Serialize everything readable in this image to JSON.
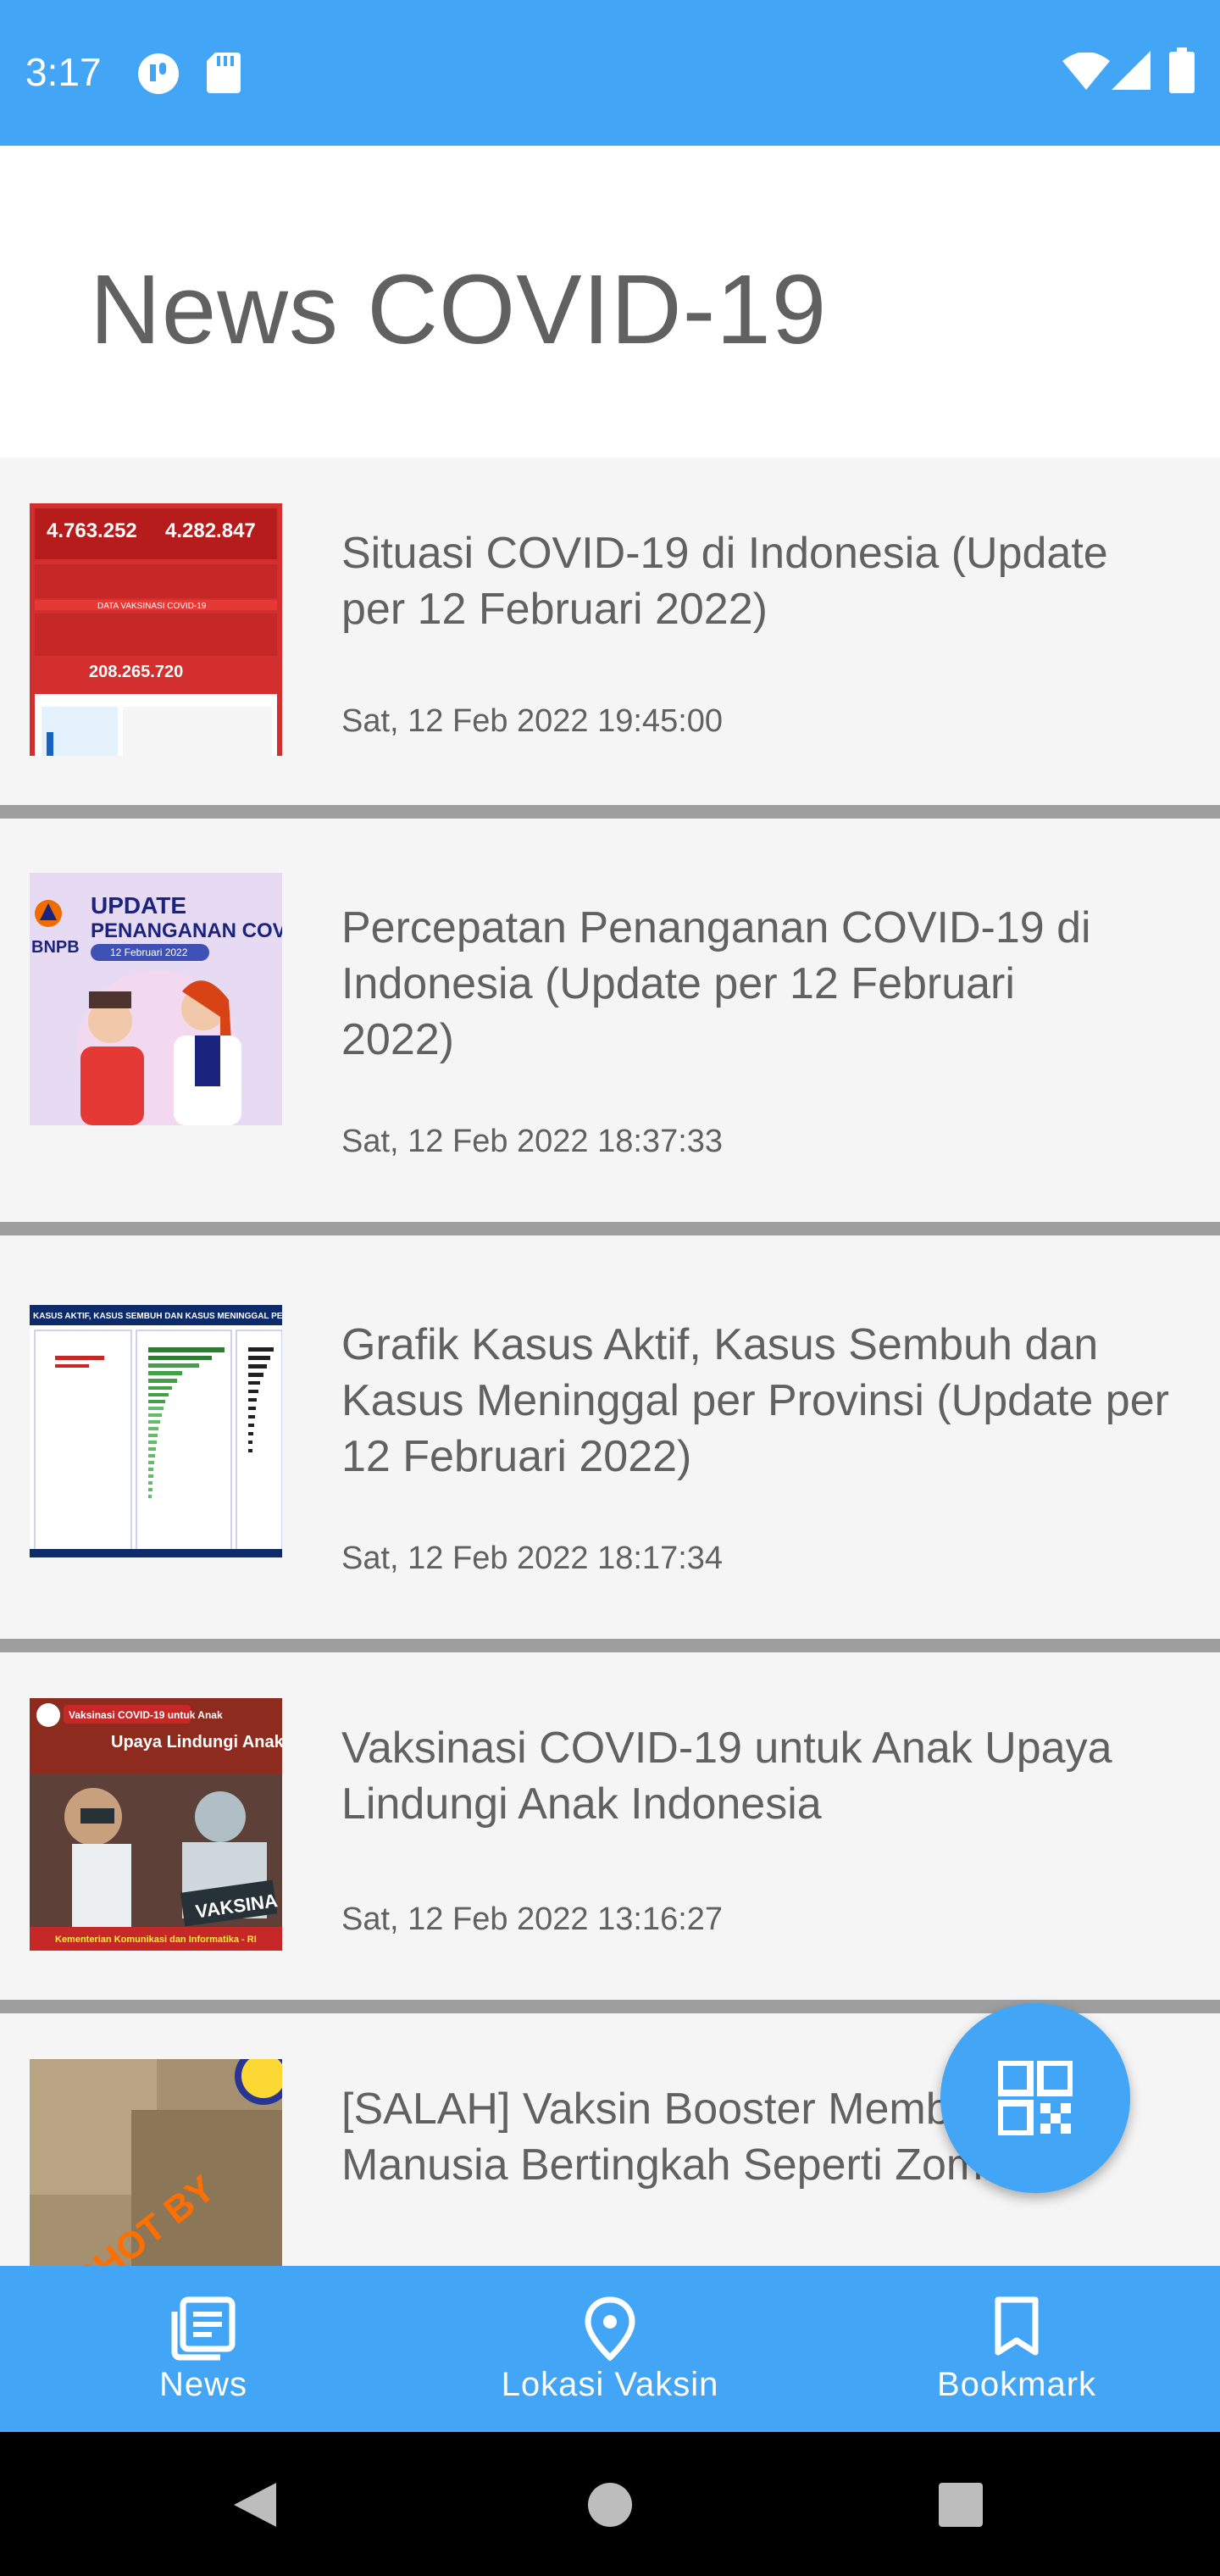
{
  "status_bar": {
    "time": "3:17"
  },
  "header": {
    "title": "News COVID-19"
  },
  "news": [
    {
      "title": "Situasi COVID-19 di Indonesia (Update per 12 Februari 2022)",
      "date": "Sat, 12 Feb 2022 19:45:00"
    },
    {
      "title": "Percepatan Penanganan COVID-19 di Indonesia (Update per 12 Februari 2022)",
      "date": "Sat, 12 Feb 2022 18:37:33"
    },
    {
      "title": "Grafik Kasus Aktif, Kasus Sembuh dan Kasus Meninggal per Provinsi (Update per 12 Februari 2022)",
      "date": "Sat, 12 Feb 2022 18:17:34"
    },
    {
      "title": "Vaksinasi COVID-19 untuk Anak Upaya Lindungi Anak Indonesia",
      "date": "Sat, 12 Feb 2022 13:16:27"
    },
    {
      "title": "[SALAH] Vaksin Booster Membuat Manusia Bertingkah Seperti Zombie",
      "date": ""
    }
  ],
  "thumbs": {
    "t1": {
      "stat_a": "4.763.252",
      "stat_b": "4.282.847",
      "stat_c": "208.265.720",
      "banner": "DATA VAKSINASI COVID-19"
    },
    "t2": {
      "line1": "UPDATE",
      "line2": "PENANGANAN COV",
      "brand": "BNPB",
      "date": "12 Februari 2022"
    },
    "t4": {
      "banner": "Vaksinasi COVID-19 untuk Anak",
      "headline": "Upaya Lindungi Anak Indonesia",
      "sign": "VAKSINA",
      "footer": "Kementerian Komunikasi dan Informatika - RI"
    },
    "t5": {
      "watermark": "SHOT BY"
    }
  },
  "bottom_nav": {
    "items": [
      {
        "label": "News",
        "icon": "news-icon"
      },
      {
        "label": "Lokasi Vaksin",
        "icon": "location-pin-icon"
      },
      {
        "label": "Bookmark",
        "icon": "bookmark-icon"
      }
    ]
  },
  "colors": {
    "primary": "#42a5f5",
    "text": "#616161",
    "divider": "#9e9e9e"
  }
}
